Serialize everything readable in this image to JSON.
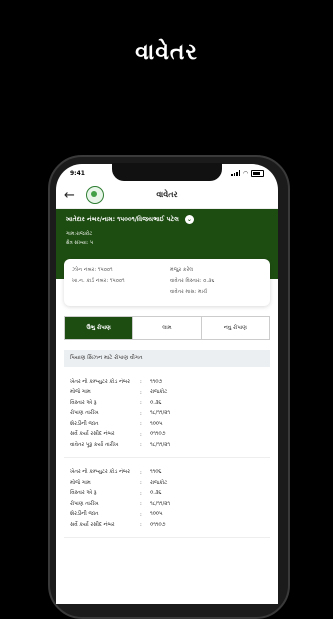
{
  "promo": {
    "title": "વાવેતર"
  },
  "status": {
    "time": "9:41"
  },
  "appbar": {
    "title": "વાવેતર",
    "back_icon": "arrow-left-icon",
    "logo": "krushi-logo"
  },
  "farmer": {
    "title": "ખાતેદાર નંબર/નામ: ૧૫૦૦૧/વિજયભાઈ પટેલ",
    "village": "ગામ:રાજકોટ",
    "survey": "ક્ષેત્ર સંખ્યા: ૫"
  },
  "summary": {
    "left": [
      "ઝોન નંબર: ૧૫૦૦૧",
      "ખા.ન. કાર્ડ નંબર: ૧૫૦૦૧"
    ],
    "right": [
      "મંજુર કરેલ",
      "વાવેતર વિસ્તાર: ૦.૩૬",
      "વાવેતર માસ: માર્ચ"
    ]
  },
  "tabs": [
    "ઉભુ રોપાણ",
    "લામ",
    "નવુ રોપાણ"
  ],
  "section_title": "પિયાણ સિઝન માટે રોપાણ વીગત",
  "crops": [
    {
      "rows": [
        {
          "label": "ખેતર નો કમ્પ્યુટર કોડ નંબર",
          "value": "૧૧૦૭"
        },
        {
          "label": "મોજે ગામ",
          "value": "રાજકોટ"
        },
        {
          "label": "વિસ્તાર એ રૂ",
          "value": "૦.૩૬"
        },
        {
          "label": "રોપાણ તારીખ",
          "value": "૧૮/૧૧/૨૧"
        },
        {
          "label": "શેરડીની જાત",
          "value": "૧૦૦૫"
        },
        {
          "label": "સર્વે કર્યા રસીદ નંબર",
          "value": "૦૧૧૦૭"
        },
        {
          "label": "વાવેતર પૂરૂ કર્યા તારીખ",
          "value": "૧૮/૧૧/૨૧"
        }
      ]
    },
    {
      "rows": [
        {
          "label": "ખેતર નો કમ્પ્યુટર કોડ નંબર",
          "value": "૧૧૦૬"
        },
        {
          "label": "મોજે ગામ",
          "value": "રાજકોટ"
        },
        {
          "label": "વિસ્તાર એ રૂ",
          "value": "૦.૩૬"
        },
        {
          "label": "રોપાણ તારીખ",
          "value": "૧૮/૧૧/૨૧"
        },
        {
          "label": "શેરડીની જાત",
          "value": "૧૦૦૫"
        },
        {
          "label": "સર્વે કર્યા રસીદ નંબર",
          "value": "૦૧૧૦૭"
        }
      ]
    }
  ]
}
